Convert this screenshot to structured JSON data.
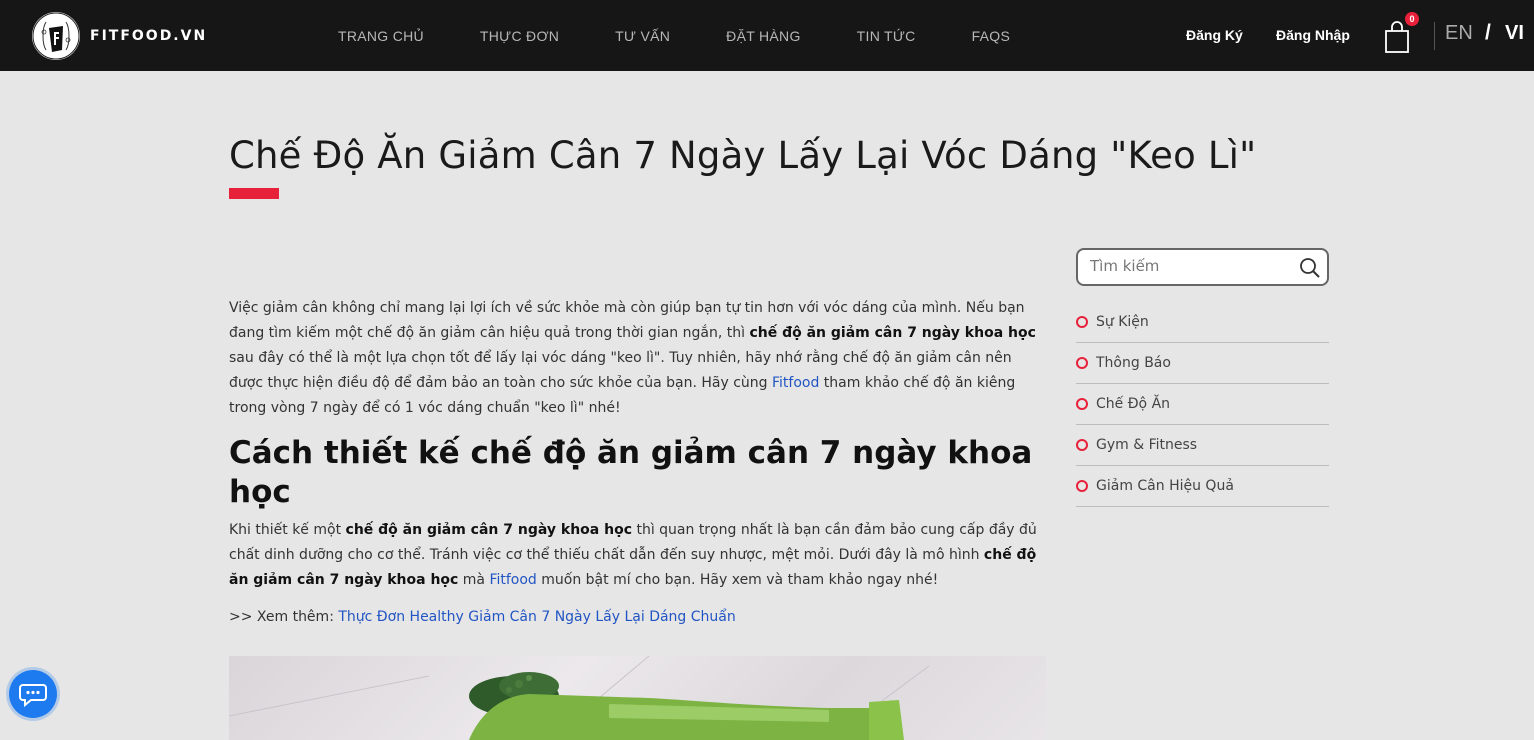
{
  "header": {
    "logo_text": "FITFOOD.VN",
    "nav": [
      "TRANG CHỦ",
      "THỰC ĐƠN",
      "TƯ VẤN",
      "ĐẶT HÀNG",
      "TIN TỨC",
      "FAQS"
    ],
    "register": "Đăng Ký",
    "login": "Đăng Nhập",
    "cart_count": "0",
    "lang_en": "EN",
    "lang_sep": "/",
    "lang_vi": "VI"
  },
  "page_title": "Chế Độ Ăn Giảm Cân 7 Ngày Lấy Lại Vóc Dáng \"Keo Lì\"",
  "article": {
    "p1_a": "Việc giảm cân không chỉ mang lại lợi ích về sức khỏe mà còn giúp bạn tự tin hơn với vóc dáng của mình. Nếu bạn đang tìm kiếm một chế độ ăn giảm cân hiệu quả trong thời gian ngắn, thì ",
    "p1_b": "chế độ ăn giảm cân 7 ngày khoa học",
    "p1_c": " sau đây có thể là một lựa chọn tốt để lấy lại vóc dáng \"keo lì\". Tuy nhiên, hãy nhớ rằng chế độ ăn giảm cân nên được thực hiện điều độ để đảm bảo an toàn cho sức khỏe của bạn. Hãy cùng ",
    "p1_link": "Fitfood",
    "p1_d": " tham khảo chế độ ăn kiêng trong vòng 7 ngày để có 1 vóc dáng chuẩn \"keo lì\" nhé!",
    "h2": "Cách thiết kế chế độ ăn giảm cân 7 ngày khoa học",
    "p2_a": "Khi thiết kế một ",
    "p2_b": "chế độ ăn giảm cân 7 ngày khoa học",
    "p2_c": " thì quan trọng nhất là bạn cần đảm bảo cung cấp đầy đủ chất dinh dưỡng cho cơ thể. Tránh việc cơ thể thiếu chất dẫn đến suy nhược, mệt mỏi. Dưới đây là mô hình ",
    "p2_d": "chế độ ăn giảm cân 7 ngày khoa học",
    "p2_e": " mà ",
    "p2_link": "Fitfood",
    "p2_f": " muốn bật mí cho bạn. Hãy xem và tham khảo ngay nhé!",
    "seemore_prefix": ">> Xem thêm: ",
    "seemore_link": "Thực Đơn Healthy Giảm Cân 7 Ngày Lấy Lại Dáng Chuẩn"
  },
  "sidebar": {
    "search_placeholder": "Tìm kiếm",
    "categories": [
      "Sự Kiện",
      "Thông Báo",
      "Chế Độ Ăn",
      "Gym & Fitness",
      "Giảm Cân Hiệu Quả"
    ]
  },
  "colors": {
    "accent": "#e8213a",
    "header_bg": "#161616",
    "page_bg": "#e6e6e6",
    "link": "#2255c4",
    "chat": "#1e7bef"
  },
  "icons": [
    "fitfood-logo-icon",
    "cart-icon",
    "search-icon",
    "chat-icon",
    "broccoli-image"
  ]
}
